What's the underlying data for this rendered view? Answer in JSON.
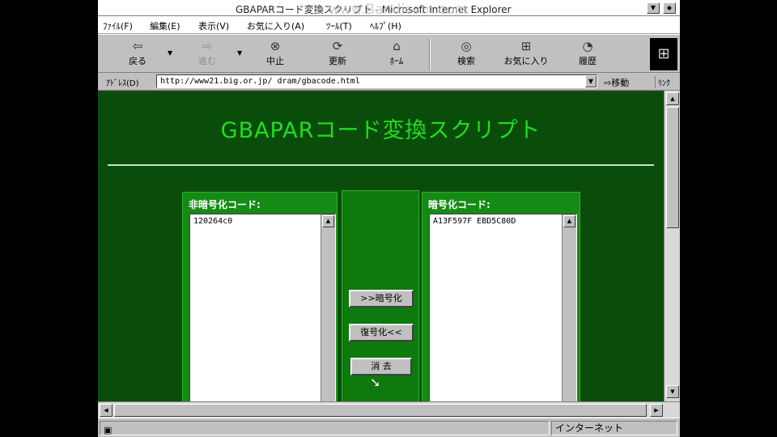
{
  "window": {
    "title": "GBAPARコード変換スクリプト - Microsoft Internet Explorer",
    "watermark": "www.Bandicam.com"
  },
  "menu": [
    "ﾌｧｲﾙ(F)",
    "編集(E)",
    "表示(V)",
    "お気に入り(A)",
    "ﾂｰﾙ(T)",
    "ﾍﾙﾌﾟ(H)"
  ],
  "toolbar": {
    "back": "戻る",
    "forward": "進む",
    "stop": "中止",
    "refresh": "更新",
    "home": "ﾎｰﾑ",
    "search": "検索",
    "favorites": "お気に入り",
    "history": "履歴"
  },
  "address": {
    "label": "ｱﾄﾞﾚｽ(D)",
    "url": "http://www21.big.or.jp/ dram/gbacode.html",
    "go": "移動",
    "links": "ﾘﾝｸ"
  },
  "page": {
    "title": "GBAPARコード変換スクリプト",
    "left_label": "非暗号化コード:",
    "left_value": "120264c0",
    "right_label": "暗号化コード:",
    "right_value": "A13F597F EBD5C80D",
    "encrypt_button": ">>暗号化",
    "decrypt_button": "復号化<<",
    "clear_button": "消 去"
  },
  "status": {
    "zone": "インターネット"
  },
  "colors": {
    "page_bg": "#0a4d0a",
    "title_green": "#22dd22",
    "panel_green": "#158a15"
  }
}
